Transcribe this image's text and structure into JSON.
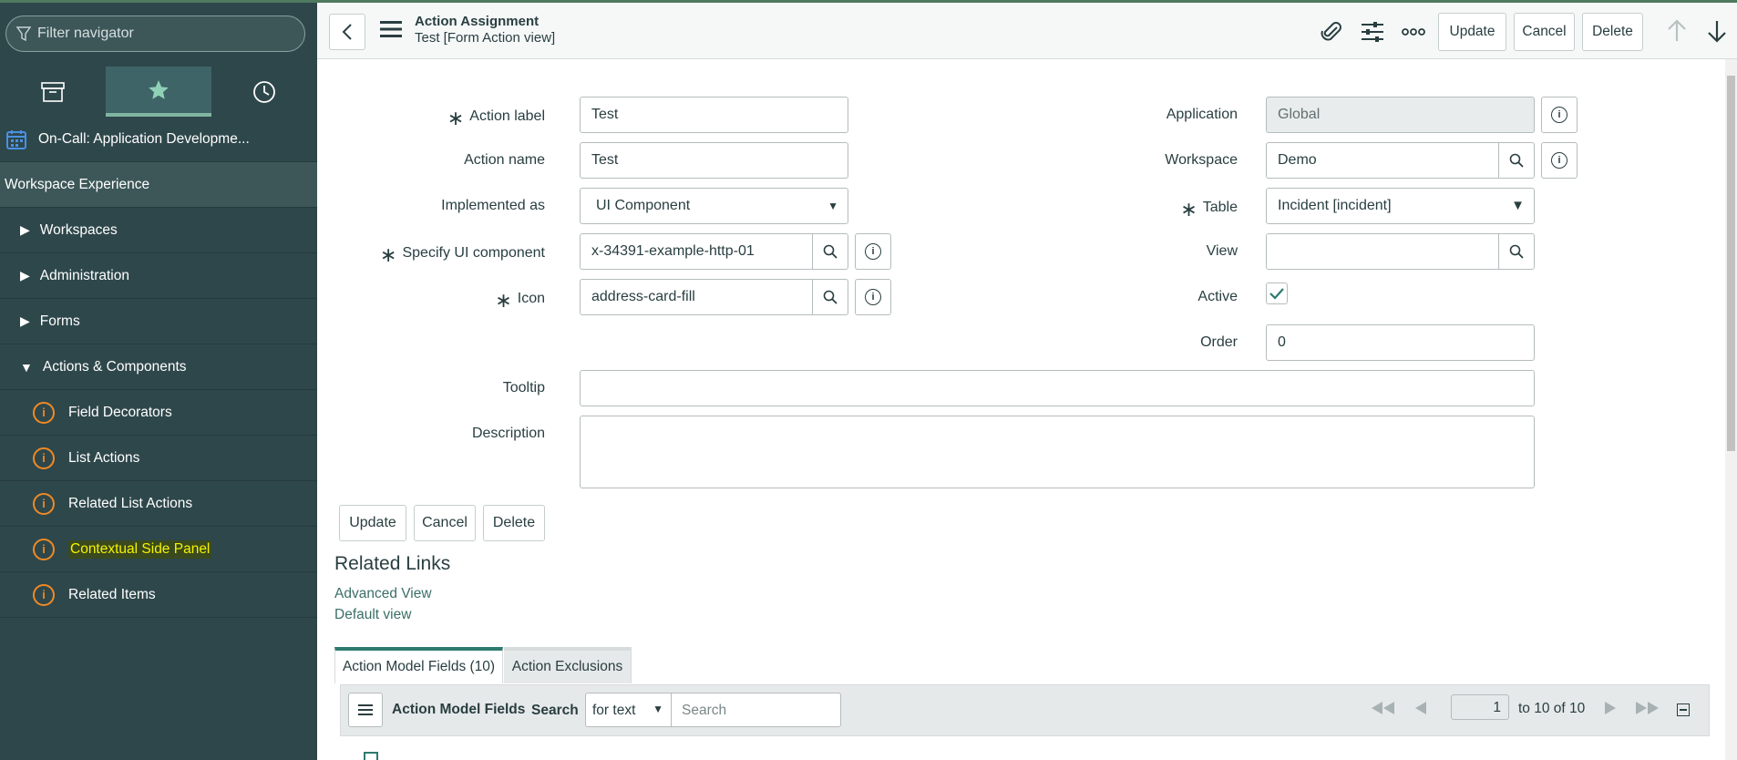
{
  "sidebar": {
    "filter_placeholder": "Filter navigator",
    "tabs": [
      {
        "name": "all-apps-icon"
      },
      {
        "name": "favorites-star-icon",
        "active": true
      },
      {
        "name": "history-clock-icon"
      }
    ],
    "app_item": "On-Call: Application Developme...",
    "section": "Workspace Experience",
    "modules": [
      {
        "label": "Workspaces",
        "expanded": false
      },
      {
        "label": "Administration",
        "expanded": false
      },
      {
        "label": "Forms",
        "expanded": false
      },
      {
        "label": "Actions & Components",
        "expanded": true
      }
    ],
    "items": [
      {
        "label": "Field Decorators"
      },
      {
        "label": "List Actions"
      },
      {
        "label": "Related List Actions"
      },
      {
        "label": "Contextual Side Panel",
        "highlighted": true
      },
      {
        "label": "Related Items"
      }
    ]
  },
  "header": {
    "title": "Action Assignment",
    "subtitle": "Test [Form Action view]",
    "buttons": {
      "update": "Update",
      "cancel": "Cancel",
      "delete": "Delete"
    }
  },
  "form": {
    "action_label": {
      "label": "Action label",
      "value": "Test"
    },
    "action_name": {
      "label": "Action name",
      "value": "Test"
    },
    "implemented_as": {
      "label": "Implemented as",
      "value": "UI Component"
    },
    "ui_component": {
      "label": "Specify UI component",
      "value": "x-34391-example-http-01"
    },
    "icon": {
      "label": "Icon",
      "value": "address-card-fill"
    },
    "application": {
      "label": "Application",
      "value": "Global"
    },
    "workspace": {
      "label": "Workspace",
      "value": "Demo"
    },
    "table": {
      "label": "Table",
      "value": "Incident [incident]"
    },
    "view": {
      "label": "View",
      "value": ""
    },
    "active": {
      "label": "Active",
      "checked": true
    },
    "order": {
      "label": "Order",
      "value": "0"
    },
    "tooltip": {
      "label": "Tooltip",
      "value": ""
    },
    "description": {
      "label": "Description",
      "value": ""
    },
    "buttons": {
      "update": "Update",
      "cancel": "Cancel",
      "delete": "Delete"
    }
  },
  "related_links": {
    "title": "Related Links",
    "links": [
      "Advanced View",
      "Default view"
    ]
  },
  "related_lists": {
    "tabs": [
      "Action Model Fields (10)",
      "Action Exclusions"
    ],
    "list_title": "Action Model Fields",
    "search_label": "Search",
    "search_select": "for text",
    "search_placeholder": "Search",
    "page_value": "1",
    "page_range": "to 10 of 10"
  }
}
